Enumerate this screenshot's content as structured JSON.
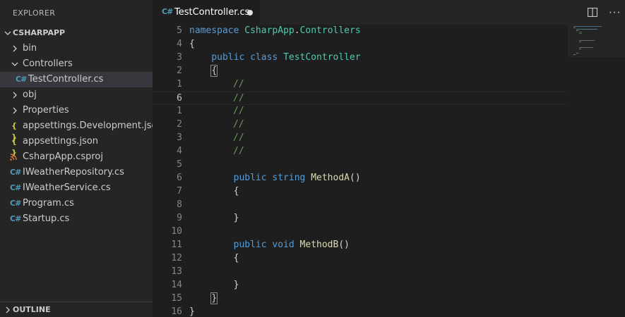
{
  "explorer": {
    "title": "EXPLORER",
    "project": "CSHARPAPP",
    "outline": "OUTLINE",
    "items": [
      {
        "label": "bin",
        "type": "folder",
        "expanded": false
      },
      {
        "label": "Controllers",
        "type": "folder",
        "expanded": true
      },
      {
        "label": "TestController.cs",
        "type": "cs",
        "selected": true
      },
      {
        "label": "obj",
        "type": "folder",
        "expanded": false
      },
      {
        "label": "Properties",
        "type": "folder",
        "expanded": false
      },
      {
        "label": "appsettings.Development.json",
        "type": "json"
      },
      {
        "label": "appsettings.json",
        "type": "json"
      },
      {
        "label": "CsharpApp.csproj",
        "type": "csproj"
      },
      {
        "label": "IWeatherRepository.cs",
        "type": "cs"
      },
      {
        "label": "IWeatherService.cs",
        "type": "cs"
      },
      {
        "label": "Program.cs",
        "type": "cs"
      },
      {
        "label": "Startup.cs",
        "type": "cs"
      }
    ]
  },
  "icons": {
    "cs": "C#",
    "json": "{ }",
    "csproj": "rss-icon",
    "chevron_right": "chevron-right-icon",
    "chevron_down": "chevron-down-icon"
  },
  "tab": {
    "label": "TestController.cs",
    "icon": "C#",
    "dirty": true
  },
  "colors": {
    "keyword": "#569cd6",
    "type": "#4ec9b0",
    "function": "#dcdcaa",
    "comment": "#6a9955",
    "text": "#d4d4d4",
    "csharp_icon": "#519aba",
    "json_icon": "#cbcb41"
  },
  "code": {
    "line_numbers": [
      "5",
      "4",
      "3",
      "2",
      "1",
      "6",
      "1",
      "2",
      "3",
      "4",
      "5",
      "6",
      "7",
      "8",
      "9",
      "10",
      "11",
      "12",
      "13",
      "14",
      "15",
      "16"
    ],
    "current_line_index": 5,
    "tokens": {
      "l0": [
        "namespace",
        " CsharpApp",
        ".",
        "Controllers"
      ],
      "l1": "{",
      "l2": [
        "    public",
        " class",
        " TestController"
      ],
      "l3": [
        "    ",
        "{"
      ],
      "comment": "//",
      "l10": [
        "        public",
        " string",
        " MethodA",
        "()"
      ],
      "l11": "        {",
      "l13": "        }",
      "l15": [
        "        public",
        " void",
        " MethodB",
        "()"
      ],
      "l16": "        {",
      "l18": "        }",
      "l19": [
        "    ",
        "}"
      ],
      "l20": "}"
    }
  }
}
